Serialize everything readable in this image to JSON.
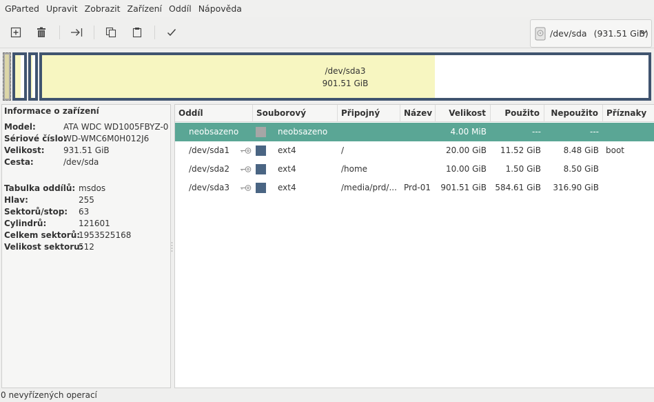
{
  "menubar": {
    "items": [
      {
        "label": "GParted"
      },
      {
        "label": "Upravit"
      },
      {
        "label": "Zobrazit"
      },
      {
        "label": "Zařízení"
      },
      {
        "label": "Oddíl"
      },
      {
        "label": "Nápověda"
      }
    ]
  },
  "toolbar": {
    "buttons": [
      {
        "icon": "new-partition-icon"
      },
      {
        "icon": "delete-icon"
      },
      {
        "icon": "resize-move-icon"
      },
      {
        "icon": "copy-icon"
      },
      {
        "icon": "paste-icon"
      },
      {
        "icon": "apply-icon"
      }
    ]
  },
  "device_selector": {
    "device": "/dev/sda",
    "size": "(931.51 GiB)"
  },
  "visual": {
    "selected_label": "/dev/sda3",
    "selected_size": "901.51 GiB",
    "colors": {
      "border": "#40546f",
      "used": "#f7f6c1",
      "unused": "#ffffff",
      "unallocated": "#a6a6a6"
    }
  },
  "device_info": {
    "title": "Informace o zařízení",
    "group1": [
      {
        "key": "Model:",
        "value": "ATA WDC WD1005FBYZ-0"
      },
      {
        "key": "Sériové číslo:",
        "value": "WD-WMC6M0H012J6"
      },
      {
        "key": "Velikost:",
        "value": "931.51 GiB"
      },
      {
        "key": "Cesta:",
        "value": "/dev/sda"
      }
    ],
    "group2": [
      {
        "key": "Tabulka oddílů:",
        "value": "msdos"
      },
      {
        "key": "Hlav:",
        "value": "255"
      },
      {
        "key": "Sektorů/stop:",
        "value": "63"
      },
      {
        "key": "Cylindrů:",
        "value": "121601"
      },
      {
        "key": "Celkem sektorů:",
        "value": "1953525168"
      },
      {
        "key": "Velikost sektoru:",
        "value": "512"
      }
    ]
  },
  "partition_table": {
    "columns": [
      "Oddíl",
      "Souborový systém",
      "Připojný bod",
      "Název",
      "Velikost",
      "Použito",
      "Nepoužito",
      "Příznaky"
    ],
    "rows": [
      {
        "partition": "neobsazeno",
        "mounted": false,
        "fs_color": "#a6a6a6",
        "filesystem": "neobsazeno",
        "mountpoint": "",
        "name": "",
        "size": "4.00 MiB",
        "used": "---",
        "unused": "---",
        "flags": "",
        "selected": true
      },
      {
        "partition": "/dev/sda1",
        "mounted": true,
        "fs_color": "#4a6583",
        "filesystem": "ext4",
        "mountpoint": "/",
        "name": "",
        "size": "20.00 GiB",
        "used": "11.52 GiB",
        "unused": "8.48 GiB",
        "flags": "boot",
        "selected": false
      },
      {
        "partition": "/dev/sda2",
        "mounted": true,
        "fs_color": "#4a6583",
        "filesystem": "ext4",
        "mountpoint": "/home",
        "name": "",
        "size": "10.00 GiB",
        "used": "1.50 GiB",
        "unused": "8.50 GiB",
        "flags": "",
        "selected": false
      },
      {
        "partition": "/dev/sda3",
        "mounted": true,
        "fs_color": "#4a6583",
        "filesystem": "ext4",
        "mountpoint": "/media/prd/...",
        "name": "Prd-01",
        "size": "901.51 GiB",
        "used": "584.61 GiB",
        "unused": "316.90 GiB",
        "flags": "",
        "selected": false
      }
    ]
  },
  "statusbar": {
    "text": "0 nevyřízených operací"
  }
}
